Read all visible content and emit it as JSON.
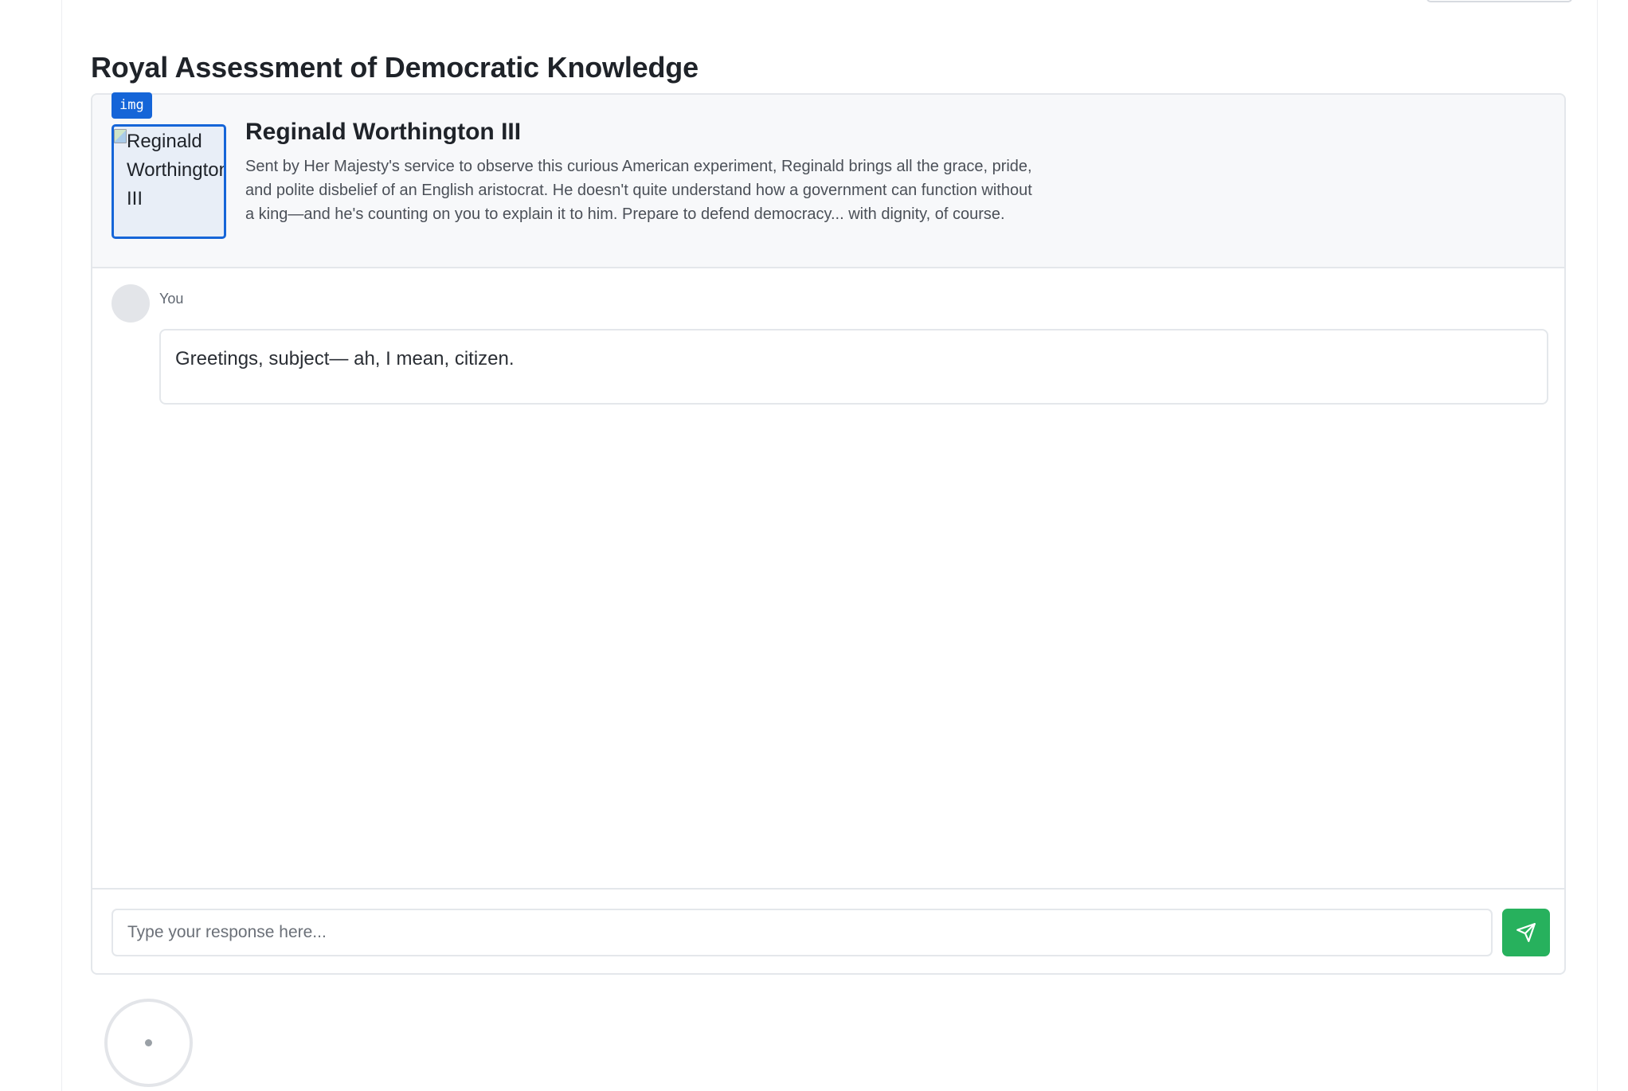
{
  "page": {
    "title": "Royal Assessment of Democratic Knowledge"
  },
  "character": {
    "tag": "img",
    "avatar_alt": "Reginald Worthington III",
    "name": "Reginald Worthington III",
    "description": "Sent by Her Majesty's service to observe this curious American experiment, Reginald brings all the grace, pride, and polite disbelief of an English aristocrat. He doesn't quite understand how a government can function without a king—and he's counting on you to explain it to him. Prepare to defend democracy... with dignity, of course."
  },
  "messages": [
    {
      "sender": "You",
      "text": "Greetings, subject— ah, I mean, citizen."
    }
  ],
  "composer": {
    "placeholder": "Type your response here...",
    "value": "",
    "send_icon": "send-icon"
  },
  "colors": {
    "accent_blue": "#1565d8",
    "send_green": "#27b15d",
    "header_bg": "#f7f8fa",
    "border": "#e4e7eb"
  }
}
